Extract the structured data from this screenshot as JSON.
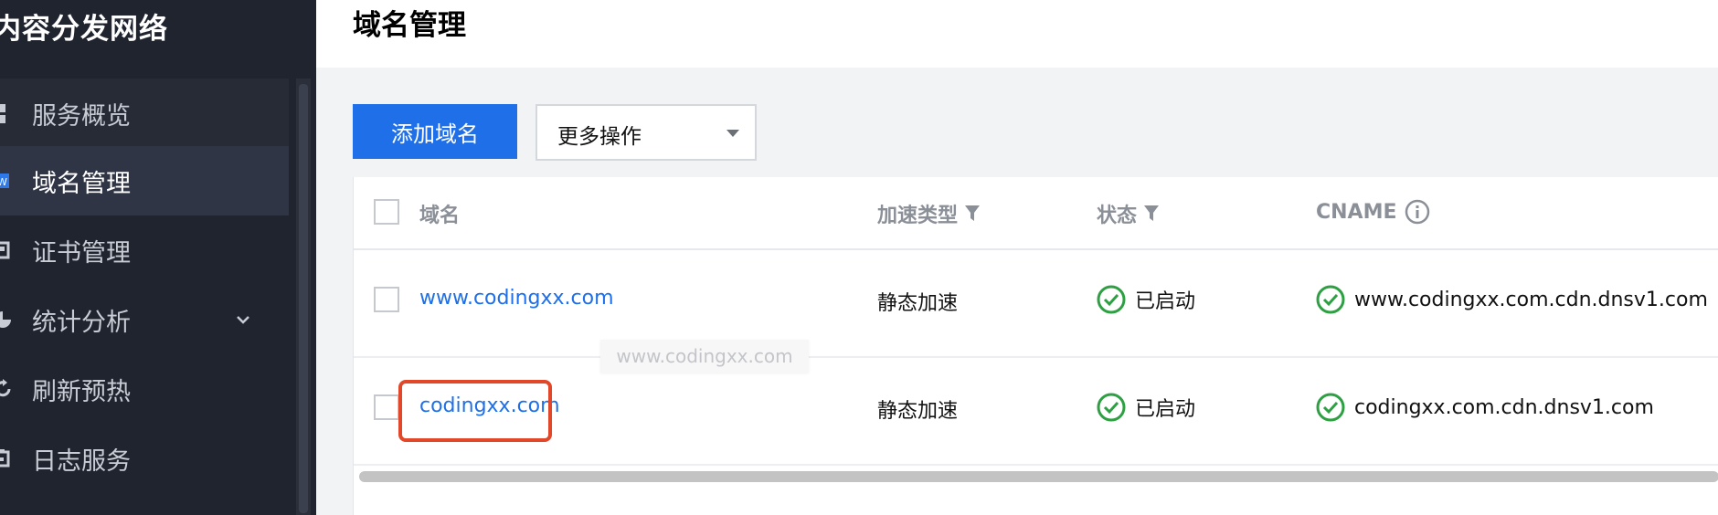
{
  "sidebar": {
    "title": "内容分发网络",
    "items": [
      {
        "label": "服务概览",
        "icon": "overview-icon"
      },
      {
        "label": "域名管理",
        "icon": "domain-icon"
      },
      {
        "label": "证书管理",
        "icon": "certificate-icon"
      },
      {
        "label": "统计分析",
        "icon": "chart-icon",
        "has_submenu": true
      },
      {
        "label": "刷新预热",
        "icon": "refresh-icon"
      },
      {
        "label": "日志服务",
        "icon": "log-icon"
      }
    ]
  },
  "header": {
    "title": "域名管理"
  },
  "toolbar": {
    "add_label": "添加域名",
    "more_label": "更多操作"
  },
  "table": {
    "columns": [
      "域名",
      "加速类型",
      "状态",
      "CNAME"
    ],
    "rows": [
      {
        "domain": "www.codingxx.com",
        "type": "静态加速",
        "status": "已启动",
        "cname": "www.codingxx.com.cdn.dnsv1.com"
      },
      {
        "domain": "codingxx.com",
        "type": "静态加速",
        "status": "已启动",
        "cname": "codingxx.com.cdn.dnsv1.com"
      }
    ]
  },
  "tooltip": {
    "text": "www.codingxx.com"
  },
  "colors": {
    "accent": "#1f6fe8",
    "success": "#2ea043",
    "highlight": "#e2472a",
    "sidebar_bg": "#20242e"
  }
}
